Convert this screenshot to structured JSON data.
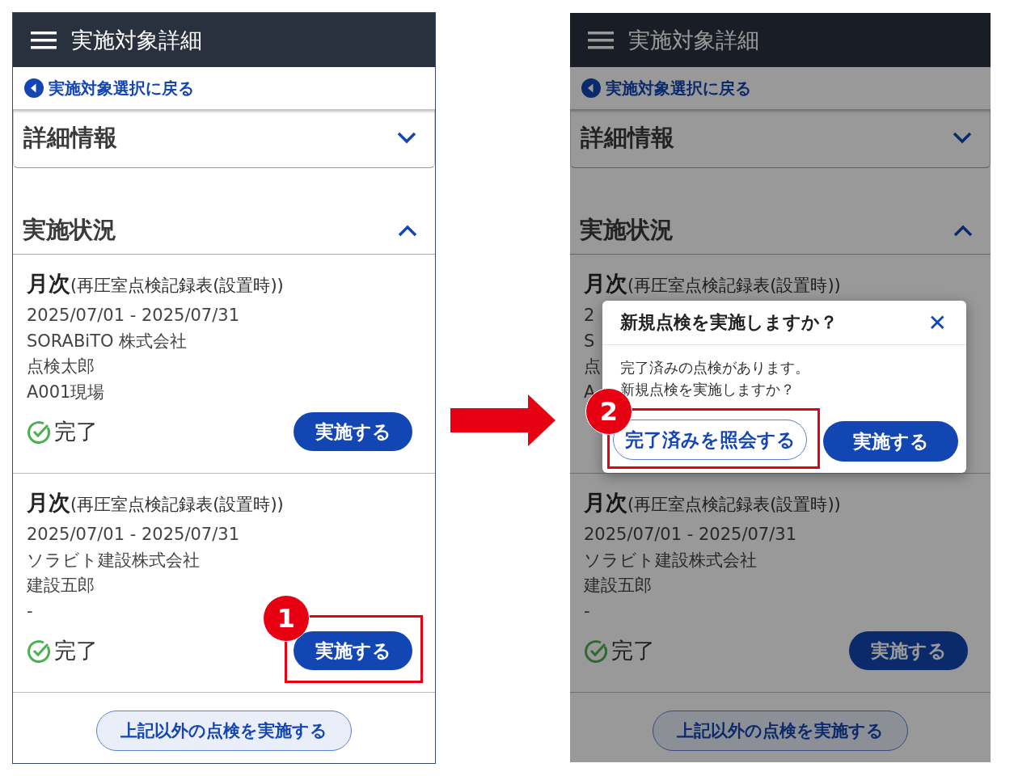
{
  "screens": [
    {
      "dimmed": false,
      "header_title": "実施対象詳細",
      "back_link": "実施対象選択に戻る",
      "sections": [
        {
          "title": "詳細情報",
          "expanded": false
        },
        {
          "title": "実施状況",
          "expanded": true
        }
      ],
      "cards": [
        {
          "title": "**月次**(再圧室点検記録表(設置時))",
          "lines": [
            "2025/07/01 - 2025/07/31",
            "SORABiTO 株式会社",
            "点検太郎",
            "A001現場"
          ],
          "status": "完了",
          "action": "実施する"
        },
        {
          "title": "**月次**(再圧室点検記録表(設置時))",
          "lines": [
            "2025/07/01 - 2025/07/31",
            "ソラビト建設株式会社",
            "建設五郎",
            "-"
          ],
          "status": "完了",
          "action": "実施する",
          "annotation": "1"
        }
      ],
      "other_button": "上記以外の点検を実施する"
    },
    {
      "dimmed": true,
      "header_title": "実施対象詳細",
      "back_link": "実施対象選択に戻る",
      "sections": [
        {
          "title": "詳細情報",
          "expanded": false
        },
        {
          "title": "実施状況",
          "expanded": true
        }
      ],
      "cards": [
        {
          "title": "**月次**(再圧室点検記録表(設置時))",
          "lines": [
            "2",
            "S",
            "点",
            "A"
          ]
        },
        {
          "title": "**月次**(再圧室点検記録表(設置時))",
          "lines": [
            "2025/07/01 - 2025/07/31",
            "ソラビト建設株式会社",
            "建設五郎",
            "-"
          ],
          "status": "完了",
          "action": "実施する"
        }
      ],
      "other_button": "上記以外の点検を実施する",
      "dialog": {
        "title": "新規点検を実施しますか？",
        "close": "✕",
        "message": [
          "完了済みの点検があります。",
          "新規点検を実施しますか？"
        ],
        "buttons": [
          {
            "label": "完了済みを照会する",
            "kind": "secondary",
            "annotation": "2"
          },
          {
            "label": "実施する",
            "kind": "primary"
          }
        ]
      }
    }
  ]
}
